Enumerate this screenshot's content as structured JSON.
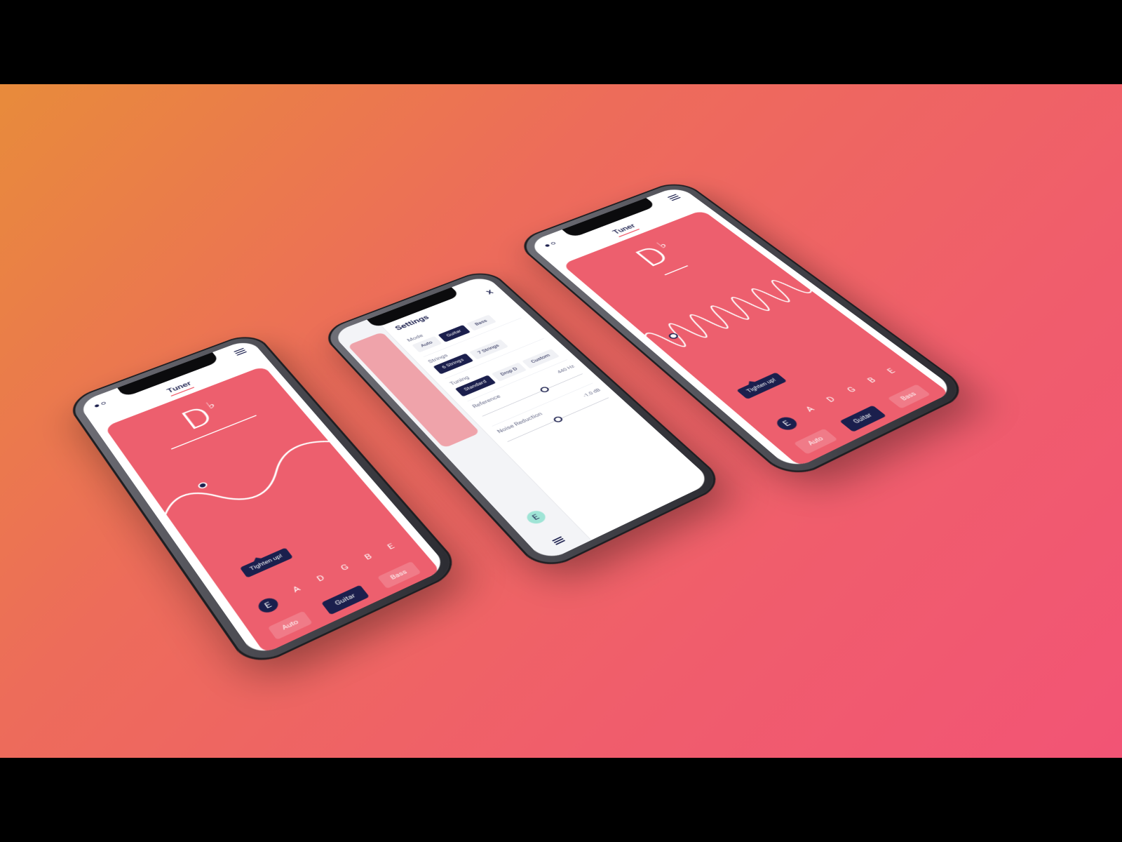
{
  "colors": {
    "brand_dark": "#1b1f4d",
    "brand_pink": "#ed5f6e",
    "gradient_from": "#e88b3b",
    "gradient_to": "#f25475"
  },
  "tuner": {
    "title": "Tuner",
    "note": "D",
    "accidental": "♭",
    "tooltip": "Tighten up!",
    "strings": [
      "E",
      "A",
      "D",
      "G",
      "B",
      "E"
    ],
    "active_string_index": 0,
    "modes": [
      "Auto",
      "Guitar",
      "Bass"
    ],
    "active_mode_index": 1
  },
  "settings": {
    "title": "Settings",
    "close": "X",
    "side_preview_note": "E",
    "rows": [
      {
        "label": "Mode",
        "options": [
          "Auto",
          "Guitar",
          "Bass"
        ],
        "active_index": 1
      },
      {
        "label": "Strings",
        "options": [
          "6 Strings",
          "7 Strings"
        ],
        "active_index": 0
      },
      {
        "label": "Tuning",
        "options": [
          "Standard",
          "Drop D",
          "Custom"
        ],
        "active_index": 0
      }
    ],
    "sliders": [
      {
        "label": "Reference",
        "value_text": "440 Hz",
        "thumb_pct": 58
      },
      {
        "label": "Noise Reduction",
        "value_text": "-1.0 dB",
        "thumb_pct": 46
      }
    ]
  }
}
